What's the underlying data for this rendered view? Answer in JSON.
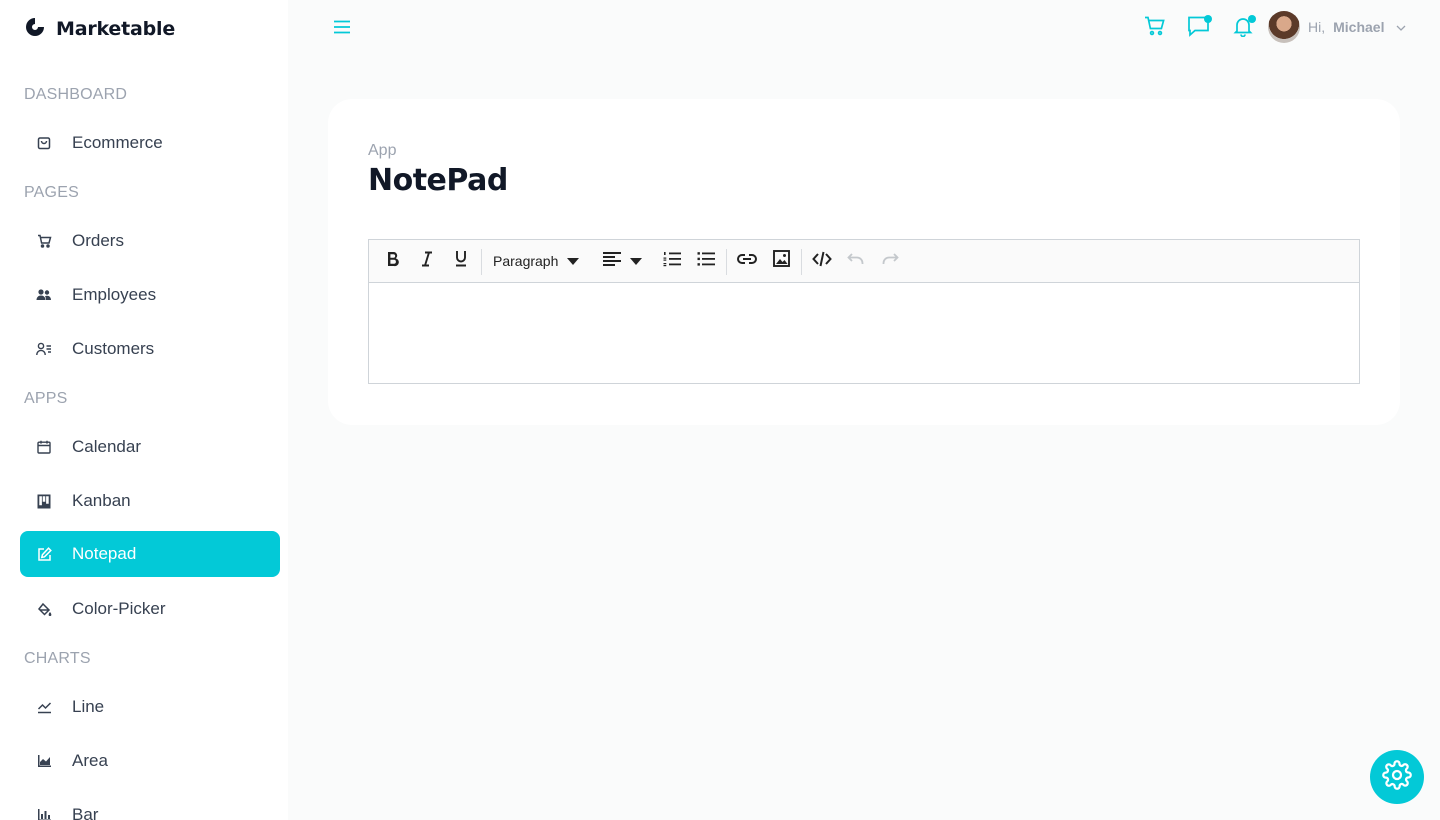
{
  "brand": {
    "name": "Marketable"
  },
  "sidebar": {
    "sections": [
      "DASHBOARD",
      "PAGES",
      "APPS",
      "CHARTS"
    ],
    "items": [
      {
        "label": "Ecommerce",
        "icon": "shopping-bag-icon"
      },
      {
        "label": "Orders",
        "icon": "cart-icon"
      },
      {
        "label": "Employees",
        "icon": "employees-icon"
      },
      {
        "label": "Customers",
        "icon": "customers-icon"
      },
      {
        "label": "Calendar",
        "icon": "calendar-icon"
      },
      {
        "label": "Kanban",
        "icon": "kanban-icon"
      },
      {
        "label": "Notepad",
        "icon": "edit-icon",
        "active": true
      },
      {
        "label": "Color-Picker",
        "icon": "paint-bucket-icon"
      },
      {
        "label": "Line",
        "icon": "line-chart-icon"
      },
      {
        "label": "Area",
        "icon": "area-chart-icon"
      },
      {
        "label": "Bar",
        "icon": "bar-chart-icon"
      }
    ]
  },
  "header": {
    "greeting": "Hi,",
    "user_name": "Michael",
    "icons": [
      "menu-icon",
      "cart-icon",
      "chat-icon",
      "bell-icon",
      "chevron-down-icon"
    ]
  },
  "page": {
    "breadcrumb": "App",
    "title": "NotePad"
  },
  "editor": {
    "format_select": "Paragraph",
    "body": ""
  },
  "colors": {
    "accent": "#03c9d7",
    "background": "#fafbfb",
    "card": "#ffffff"
  }
}
